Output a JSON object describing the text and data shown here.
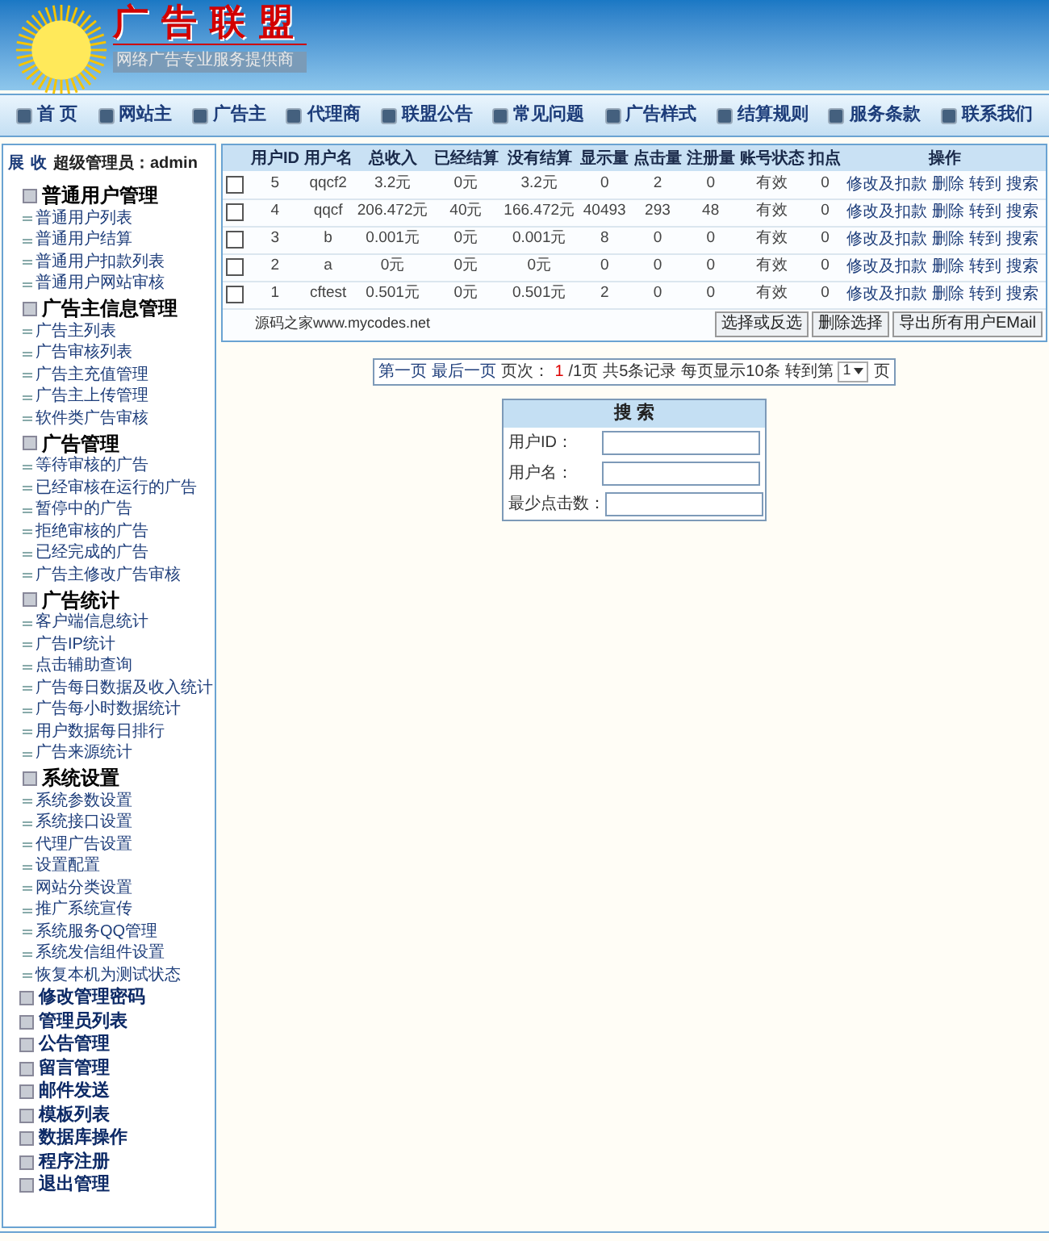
{
  "header": {
    "logo_title": "广告联盟",
    "logo_subtitle": "网络广告专业服务提供商"
  },
  "nav": [
    {
      "label": "首 页"
    },
    {
      "label": "网站主"
    },
    {
      "label": "广告主"
    },
    {
      "label": "代理商"
    },
    {
      "label": "联盟公告"
    },
    {
      "label": "常见问题"
    },
    {
      "label": "广告样式"
    },
    {
      "label": "结算规则"
    },
    {
      "label": "服务条款"
    },
    {
      "label": "联系我们"
    }
  ],
  "sidebar": {
    "expand": "展",
    "collapse": "收",
    "user": "超级管理员：admin",
    "items": [
      {
        "label": "普通用户管理",
        "children": [
          {
            "label": "普通用户列表"
          },
          {
            "label": "普通用户结算"
          },
          {
            "label": "普通用户扣款列表"
          },
          {
            "label": "普通用户网站审核"
          }
        ]
      },
      {
        "label": "广告主信息管理",
        "children": [
          {
            "label": "广告主列表"
          },
          {
            "label": "广告审核列表"
          },
          {
            "label": "广告主充值管理"
          },
          {
            "label": "广告主上传管理"
          },
          {
            "label": "软件类广告审核"
          }
        ]
      },
      {
        "label": "广告管理",
        "children": [
          {
            "label": "等待审核的广告"
          },
          {
            "label": "已经审核在运行的广告"
          },
          {
            "label": "暂停中的广告"
          },
          {
            "label": "拒绝审核的广告"
          },
          {
            "label": "已经完成的广告"
          },
          {
            "label": "广告主修改广告审核"
          }
        ]
      },
      {
        "label": "广告统计",
        "children": [
          {
            "label": "客户端信息统计"
          },
          {
            "label": "广告IP统计"
          },
          {
            "label": "点击辅助查询"
          },
          {
            "label": "广告每日数据及收入统计"
          },
          {
            "label": "广告每小时数据统计"
          },
          {
            "label": "用户数据每日排行"
          },
          {
            "label": "广告来源统计"
          }
        ]
      },
      {
        "label": "系统设置",
        "children": [
          {
            "label": "系统参数设置"
          },
          {
            "label": "系统接口设置"
          },
          {
            "label": "代理广告设置"
          },
          {
            "label": "设置配置"
          },
          {
            "label": "网站分类设置"
          },
          {
            "label": "推广系统宣传"
          },
          {
            "label": "系统服务QQ管理"
          },
          {
            "label": "系统发信组件设置"
          },
          {
            "label": "恢复本机为测试状态"
          }
        ]
      },
      {
        "label": "修改管理密码"
      },
      {
        "label": "管理员列表"
      },
      {
        "label": "公告管理"
      },
      {
        "label": "留言管理"
      },
      {
        "label": "邮件发送"
      },
      {
        "label": "模板列表"
      },
      {
        "label": "数据库操作"
      },
      {
        "label": "程序注册"
      },
      {
        "label": "退出管理"
      }
    ]
  },
  "table": {
    "columns": [
      "用户ID",
      "用户名",
      "总收入",
      "已经结算",
      "没有结算",
      "显示量",
      "点击量",
      "注册量",
      "账号状态",
      "扣点",
      "操作"
    ],
    "rows": [
      {
        "checked": false,
        "cells": [
          "5",
          "qqcf2",
          "3.2元",
          "0元",
          "3.2元",
          "0",
          "2",
          "0",
          "有效",
          "0"
        ],
        "actions": [
          "修改及扣款",
          "删除",
          "转到",
          "搜索"
        ]
      },
      {
        "checked": false,
        "cells": [
          "4",
          "qqcf",
          "206.472元",
          "40元",
          "166.472元",
          "40493",
          "293",
          "48",
          "有效",
          "0"
        ],
        "actions": [
          "修改及扣款",
          "删除",
          "转到",
          "搜索"
        ]
      },
      {
        "checked": false,
        "cells": [
          "3",
          "b",
          "0.001元",
          "0元",
          "0.001元",
          "8",
          "0",
          "0",
          "有效",
          "0"
        ],
        "actions": [
          "修改及扣款",
          "删除",
          "转到",
          "搜索"
        ]
      },
      {
        "checked": false,
        "cells": [
          "2",
          "a",
          "0元",
          "0元",
          "0元",
          "0",
          "0",
          "0",
          "有效",
          "0"
        ],
        "actions": [
          "修改及扣款",
          "删除",
          "转到",
          "搜索"
        ]
      },
      {
        "checked": false,
        "cells": [
          "1",
          "cftest",
          "0.501元",
          "0元",
          "0.501元",
          "2",
          "0",
          "0",
          "有效",
          "0"
        ],
        "actions": [
          "修改及扣款",
          "删除",
          "转到",
          "搜索"
        ]
      }
    ],
    "footer_note": "源码之家www.mycodes.net",
    "buttons": [
      "选择或反选",
      "删除选择",
      "导出所有用户EMail"
    ]
  },
  "pagination": {
    "first": "第一页",
    "last": "最后一页",
    "page_label": "页次：",
    "current": "1",
    "total": "/1页",
    "records": "共5条记录",
    "per_page": "每页显示10条",
    "goto": "转到第",
    "page_select": "1",
    "suffix": "页"
  },
  "search": {
    "title": "搜 索",
    "fields": [
      {
        "label": "用户ID："
      },
      {
        "label": "用户名："
      },
      {
        "label": "最少点击数："
      }
    ]
  }
}
